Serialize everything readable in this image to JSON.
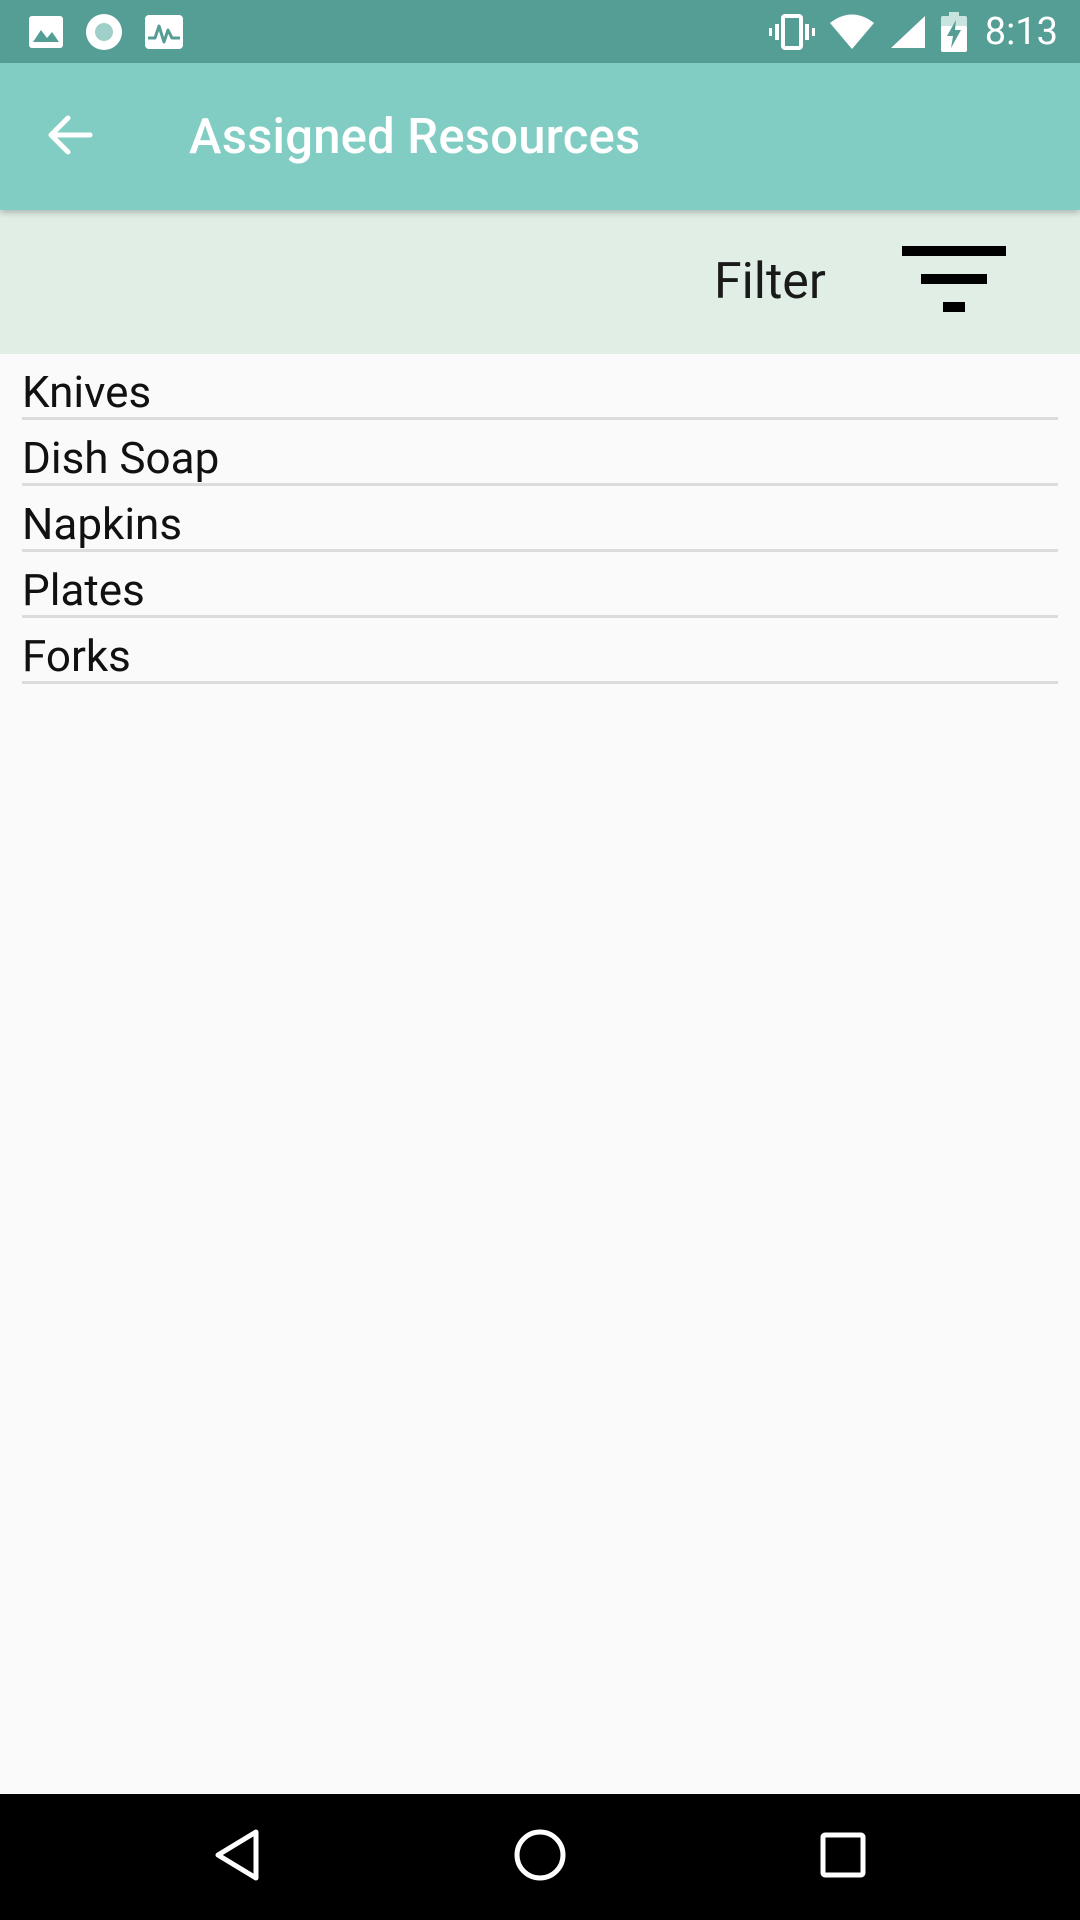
{
  "status_bar": {
    "time": "8:13",
    "left_icons": [
      "image-icon",
      "record-icon",
      "pulse-icon"
    ],
    "right_icons": [
      "vibrate-icon",
      "wifi-icon",
      "cell-signal-icon",
      "battery-charging-icon"
    ],
    "background": "#559e96"
  },
  "app_bar": {
    "title": "Assigned Resources",
    "back_icon": "arrow-left-icon",
    "background": "#82cdc3"
  },
  "filter_bar": {
    "label": "Filter",
    "icon": "filter-icon",
    "background": "#e0eee6"
  },
  "resources": [
    {
      "name": "Knives"
    },
    {
      "name": "Dish Soap"
    },
    {
      "name": "Napkins"
    },
    {
      "name": "Plates"
    },
    {
      "name": "Forks"
    }
  ],
  "nav_bar": {
    "buttons": [
      "nav-back-icon",
      "nav-home-icon",
      "nav-recents-icon"
    ]
  }
}
